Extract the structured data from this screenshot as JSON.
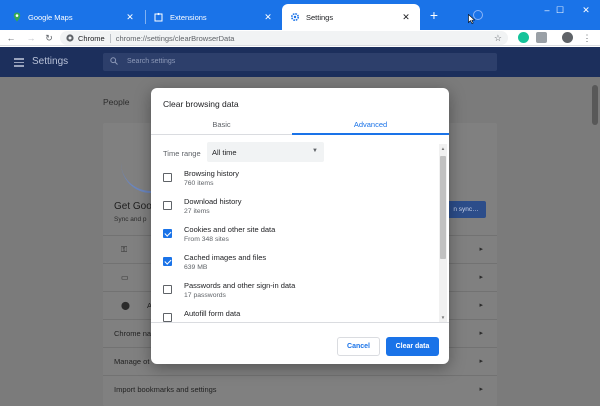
{
  "browser": {
    "tabs": [
      {
        "title": "Google Maps",
        "icon": "maps-icon",
        "active": false
      },
      {
        "title": "Extensions",
        "icon": "puzzle-icon",
        "active": false
      },
      {
        "title": "Settings",
        "icon": "gear-icon",
        "active": true
      }
    ],
    "new_tab": "+",
    "window_controls": {
      "minimize": "–",
      "maximize": "☐",
      "close": "✕"
    },
    "tab_close": "✕",
    "accent": "#1a73e8"
  },
  "toolbar": {
    "back": "←",
    "forward": "→",
    "reload": "↻",
    "site_label": "Chrome",
    "url": "chrome://settings/clearBrowserData",
    "star": "☆",
    "menu": "⋮"
  },
  "settings": {
    "title": "Settings",
    "search_placeholder": "Search settings",
    "people_label": "People",
    "get_label": "Get Goo",
    "sync_label": "Sync and p",
    "sync_button": "n sync…",
    "rows": [
      {
        "label": "",
        "icon": "key-icon"
      },
      {
        "label": "",
        "icon": "card-icon"
      },
      {
        "label": "A",
        "icon": "location-icon"
      },
      {
        "label": "Chrome na",
        "icon": ""
      },
      {
        "label": "Manage ot",
        "icon": ""
      },
      {
        "label": "Import bookmarks and settings",
        "icon": ""
      }
    ]
  },
  "dialog": {
    "title": "Clear browsing data",
    "tabs": [
      {
        "label": "Basic",
        "active": false
      },
      {
        "label": "Advanced",
        "active": true
      }
    ],
    "time_range_label": "Time range",
    "time_range_value": "All time",
    "options": [
      {
        "label": "Browsing history",
        "sub": "760 items",
        "checked": false
      },
      {
        "label": "Download history",
        "sub": "27 items",
        "checked": false
      },
      {
        "label": "Cookies and other site data",
        "sub": "From 348 sites",
        "checked": true
      },
      {
        "label": "Cached images and files",
        "sub": "639 MB",
        "checked": true
      },
      {
        "label": "Passwords and other sign-in data",
        "sub": "17 passwords",
        "checked": false
      },
      {
        "label": "Autofill form data",
        "sub": "",
        "checked": false
      }
    ],
    "cancel_label": "Cancel",
    "clear_label": "Clear data"
  }
}
